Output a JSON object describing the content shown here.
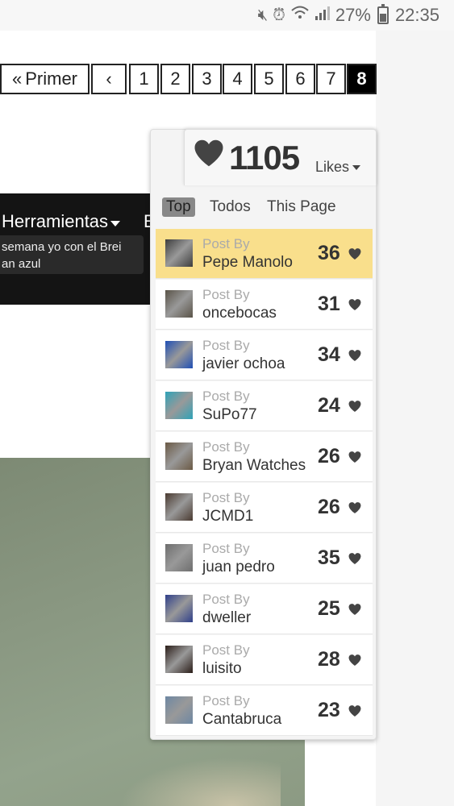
{
  "status_bar": {
    "battery_percent": "27%",
    "time": "22:35",
    "icons": [
      "mute-icon",
      "alarm-icon",
      "wifi-icon",
      "signal-icon",
      "battery-icon"
    ]
  },
  "pagination": {
    "first_label": "Primer",
    "first_glyph": "«",
    "prev_glyph": "‹",
    "pages": [
      "1",
      "2",
      "3",
      "4",
      "5",
      "6",
      "7",
      "8"
    ],
    "active_page": "8"
  },
  "nav": {
    "menu_label": "Herramientas",
    "menu_next": "E",
    "tooltip_line1": "semana yo con el Brei",
    "tooltip_line2": "an azul"
  },
  "likes": {
    "count": "1105",
    "label": "Likes",
    "tabs": [
      "Top",
      "Todos",
      "This Page"
    ],
    "active_tab": "Top",
    "items": [
      {
        "post_by": "Post By",
        "author": "Pepe Manolo",
        "count": "36",
        "avatar": "#3d3d3d"
      },
      {
        "post_by": "Post By",
        "author": "oncebocas",
        "count": "31",
        "avatar": "#5a5448"
      },
      {
        "post_by": "Post By",
        "author": "javier ochoa",
        "count": "34",
        "avatar": "#1f4fb5"
      },
      {
        "post_by": "Post By",
        "author": "SuPo77",
        "count": "24",
        "avatar": "#2ea3b8"
      },
      {
        "post_by": "Post By",
        "author": "Bryan Watches",
        "count": "26",
        "avatar": "#6b5a45"
      },
      {
        "post_by": "Post By",
        "author": "JCMD1",
        "count": "26",
        "avatar": "#4a3a30"
      },
      {
        "post_by": "Post By",
        "author": "juan pedro",
        "count": "35",
        "avatar": "#6e6e6e"
      },
      {
        "post_by": "Post By",
        "author": "dweller",
        "count": "25",
        "avatar": "#2f3f8a"
      },
      {
        "post_by": "Post By",
        "author": "luisito",
        "count": "28",
        "avatar": "#2a1d18"
      },
      {
        "post_by": "Post By",
        "author": "Cantabruca",
        "count": "23",
        "avatar": "#6d87a3"
      }
    ]
  },
  "colors": {
    "highlight_row": "#f9df8c",
    "active_page_bg": "#000000",
    "heart": "#444444"
  }
}
